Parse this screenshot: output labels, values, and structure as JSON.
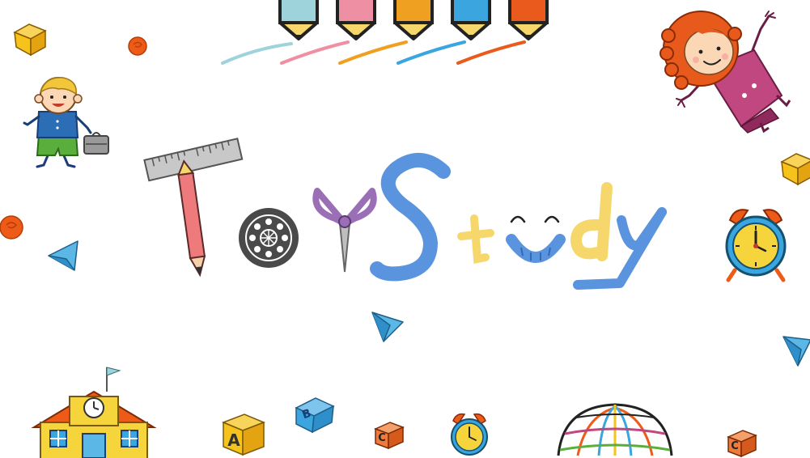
{
  "title": {
    "letters": [
      "T",
      "o",
      "y",
      "S",
      "t",
      "u",
      "d",
      "y"
    ]
  },
  "blocks": {
    "a": "A",
    "b": "B",
    "c1": "C",
    "c2": "C"
  },
  "icons": {
    "crayons": "crayon-icon",
    "boy": "boy-character-icon",
    "girl": "girl-character-icon",
    "school": "school-building-icon",
    "globe": "globe-icon",
    "clock": "alarm-clock-icon",
    "paper_plane": "paper-plane-icon",
    "cube": "cube-icon",
    "ball": "ball-icon"
  },
  "colors": {
    "crayon_blue": "#9fd3dc",
    "crayon_pink": "#ef8fa3",
    "crayon_orange": "#f0a021",
    "crayon_sky": "#3aa5de",
    "crayon_red": "#ea5a1c",
    "title_blue": "#5b94de",
    "title_yellow": "#f6d76c",
    "title_pink": "#ee7a7c",
    "title_purple": "#9b6fb6",
    "title_grey": "#4a4a4a",
    "cube_yellow": "#f6c21c",
    "plane_blue": "#5ab7e6",
    "ball_orange": "#ee5a18"
  }
}
